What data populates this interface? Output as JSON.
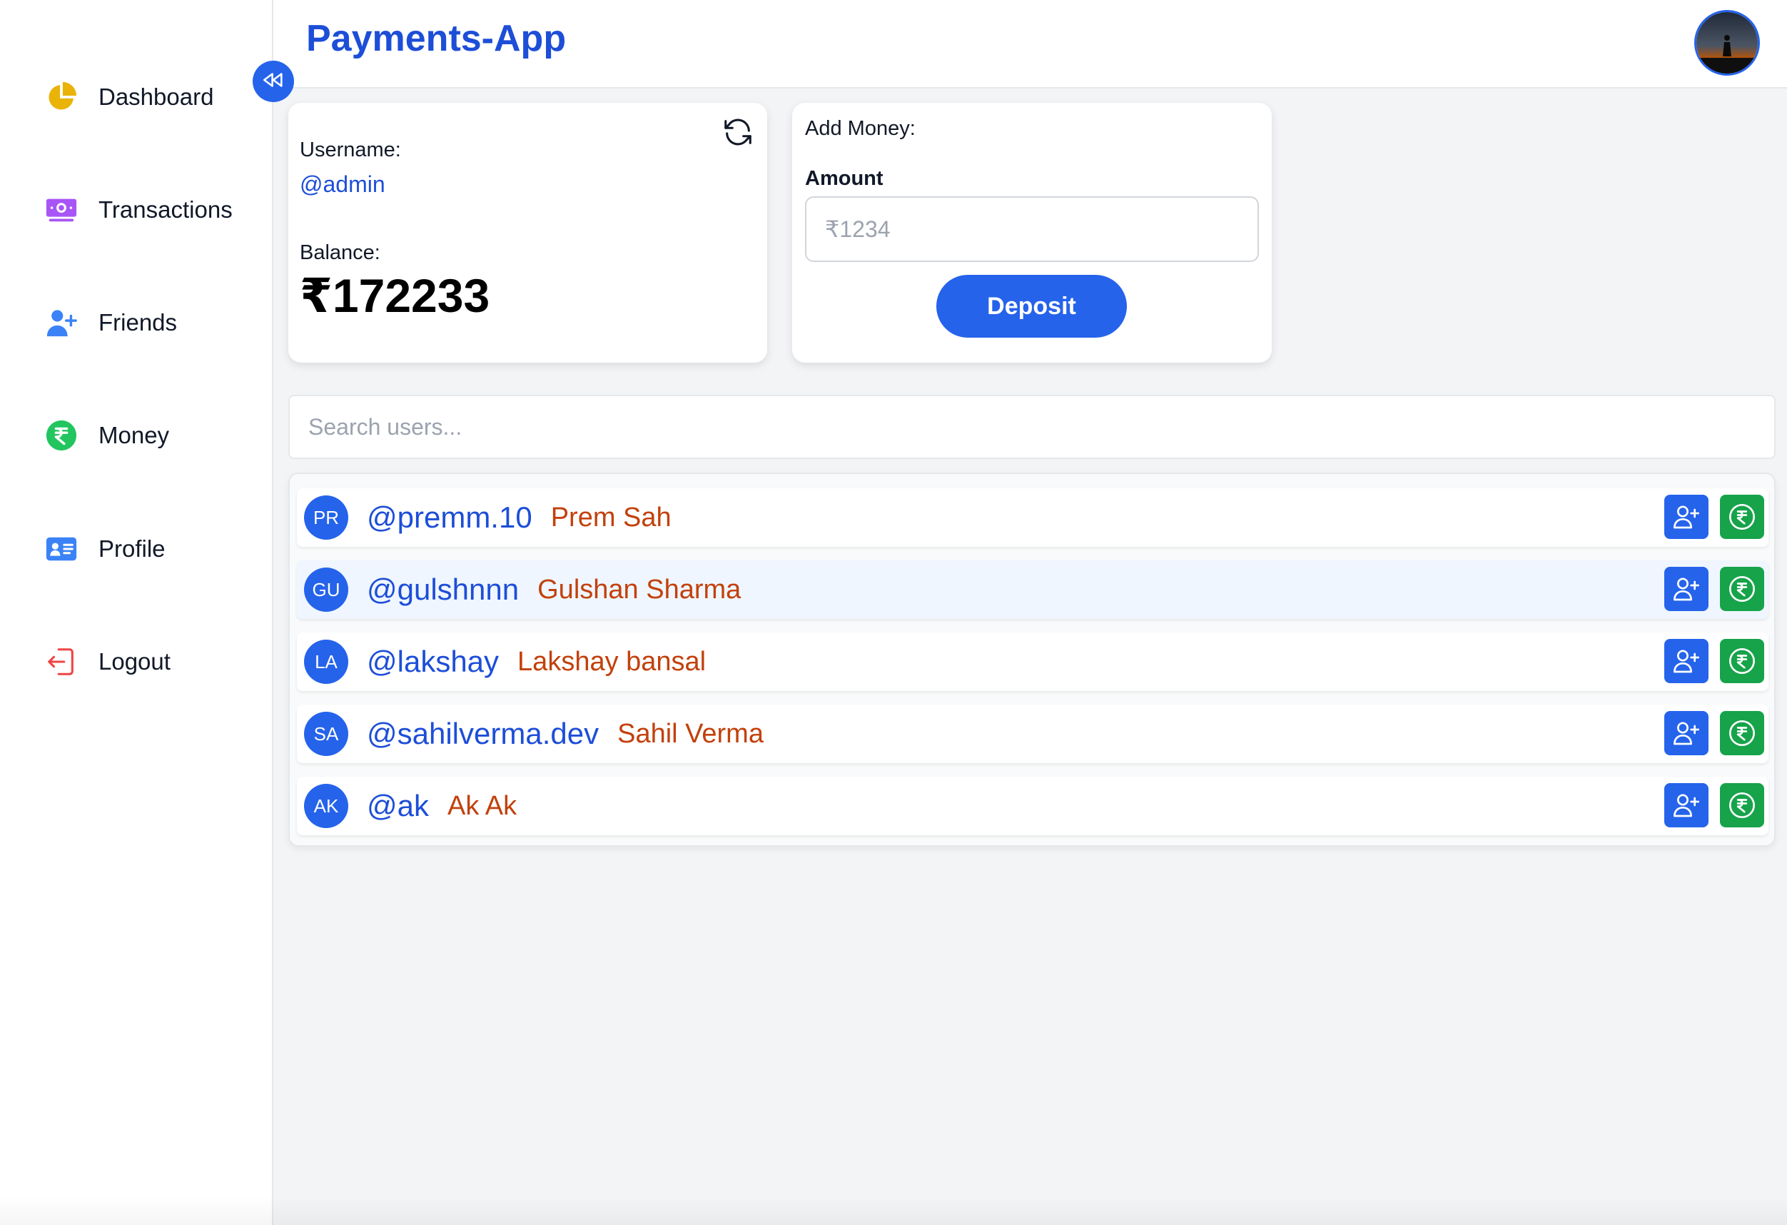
{
  "app": {
    "title": "Payments-App"
  },
  "sidebar": {
    "items": [
      {
        "label": "Dashboard",
        "icon": "pie-chart-icon",
        "color": "#eab308"
      },
      {
        "label": "Transactions",
        "icon": "banknote-icon",
        "color": "#a855f7"
      },
      {
        "label": "Friends",
        "icon": "user-plus-icon",
        "color": "#3b82f6"
      },
      {
        "label": "Money",
        "icon": "rupee-coin-icon",
        "color": "#22c55e"
      },
      {
        "label": "Profile",
        "icon": "id-card-icon",
        "color": "#3b82f6"
      },
      {
        "label": "Logout",
        "icon": "logout-icon",
        "color": "#ef4444"
      }
    ]
  },
  "account": {
    "username_label": "Username:",
    "username": "@admin",
    "balance_label": "Balance:",
    "balance": "₹172233"
  },
  "deposit": {
    "title": "Add Money:",
    "amount_label": "Amount",
    "amount_placeholder": "₹1234",
    "button_label": "Deposit"
  },
  "search": {
    "placeholder": "Search users..."
  },
  "users": [
    {
      "initials": "PR",
      "username": "@premm.10",
      "name": "Prem Sah"
    },
    {
      "initials": "GU",
      "username": "@gulshnnn",
      "name": "Gulshan Sharma"
    },
    {
      "initials": "LA",
      "username": "@lakshay",
      "name": "Lakshay bansal"
    },
    {
      "initials": "SA",
      "username": "@sahilverma.dev",
      "name": "Sahil Verma"
    },
    {
      "initials": "AK",
      "username": "@ak",
      "name": "Ak Ak"
    }
  ],
  "colors": {
    "accent": "#2563eb",
    "success": "#16a34a",
    "name_text": "#c2410c"
  }
}
